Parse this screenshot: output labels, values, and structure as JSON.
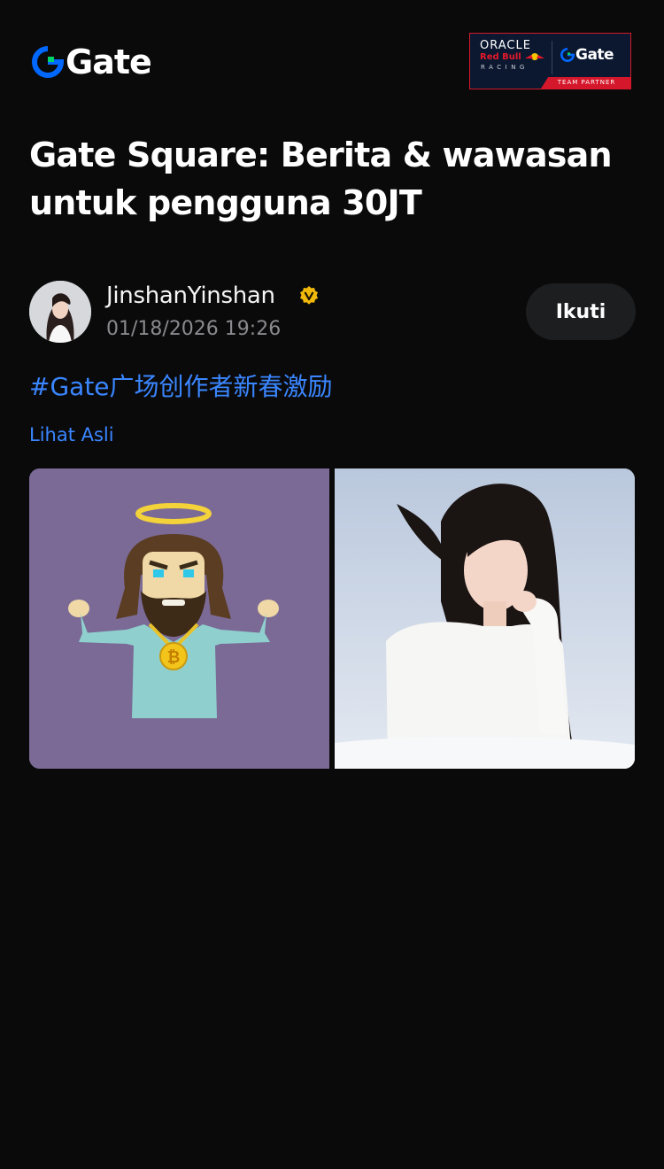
{
  "header": {
    "logo_text": "Gate",
    "partner_badge": {
      "line1": "ORACLE",
      "line2": "Red Bull",
      "line3": "RACING",
      "brand": "Gate",
      "footer": "TEAM PARTNER"
    }
  },
  "headline": "Gate Square: Berita & wawasan untuk pengguna 30JT",
  "post": {
    "author_name": "JinshanYinshan",
    "timestamp": "01/18/2026 19:26",
    "follow_label": "Ikuti",
    "hashtag": "#Gate广场创作者新春激励",
    "view_original_label": "Lihat Asli",
    "images": [
      {
        "name": "cartoon-saint-bitcoin-image"
      },
      {
        "name": "woman-portrait-image"
      }
    ]
  },
  "colors": {
    "background": "#0a0a0b",
    "link": "#3a86ff",
    "follow_button_bg": "#1d1e20",
    "verified_badge": "#f0b90b",
    "brand_blue": "#0068ff",
    "brand_green": "#00d26a",
    "partner_red": "#d5172b"
  },
  "icons": [
    "gate-logo-icon",
    "verified-badge-icon",
    "red-bull-icon"
  ]
}
